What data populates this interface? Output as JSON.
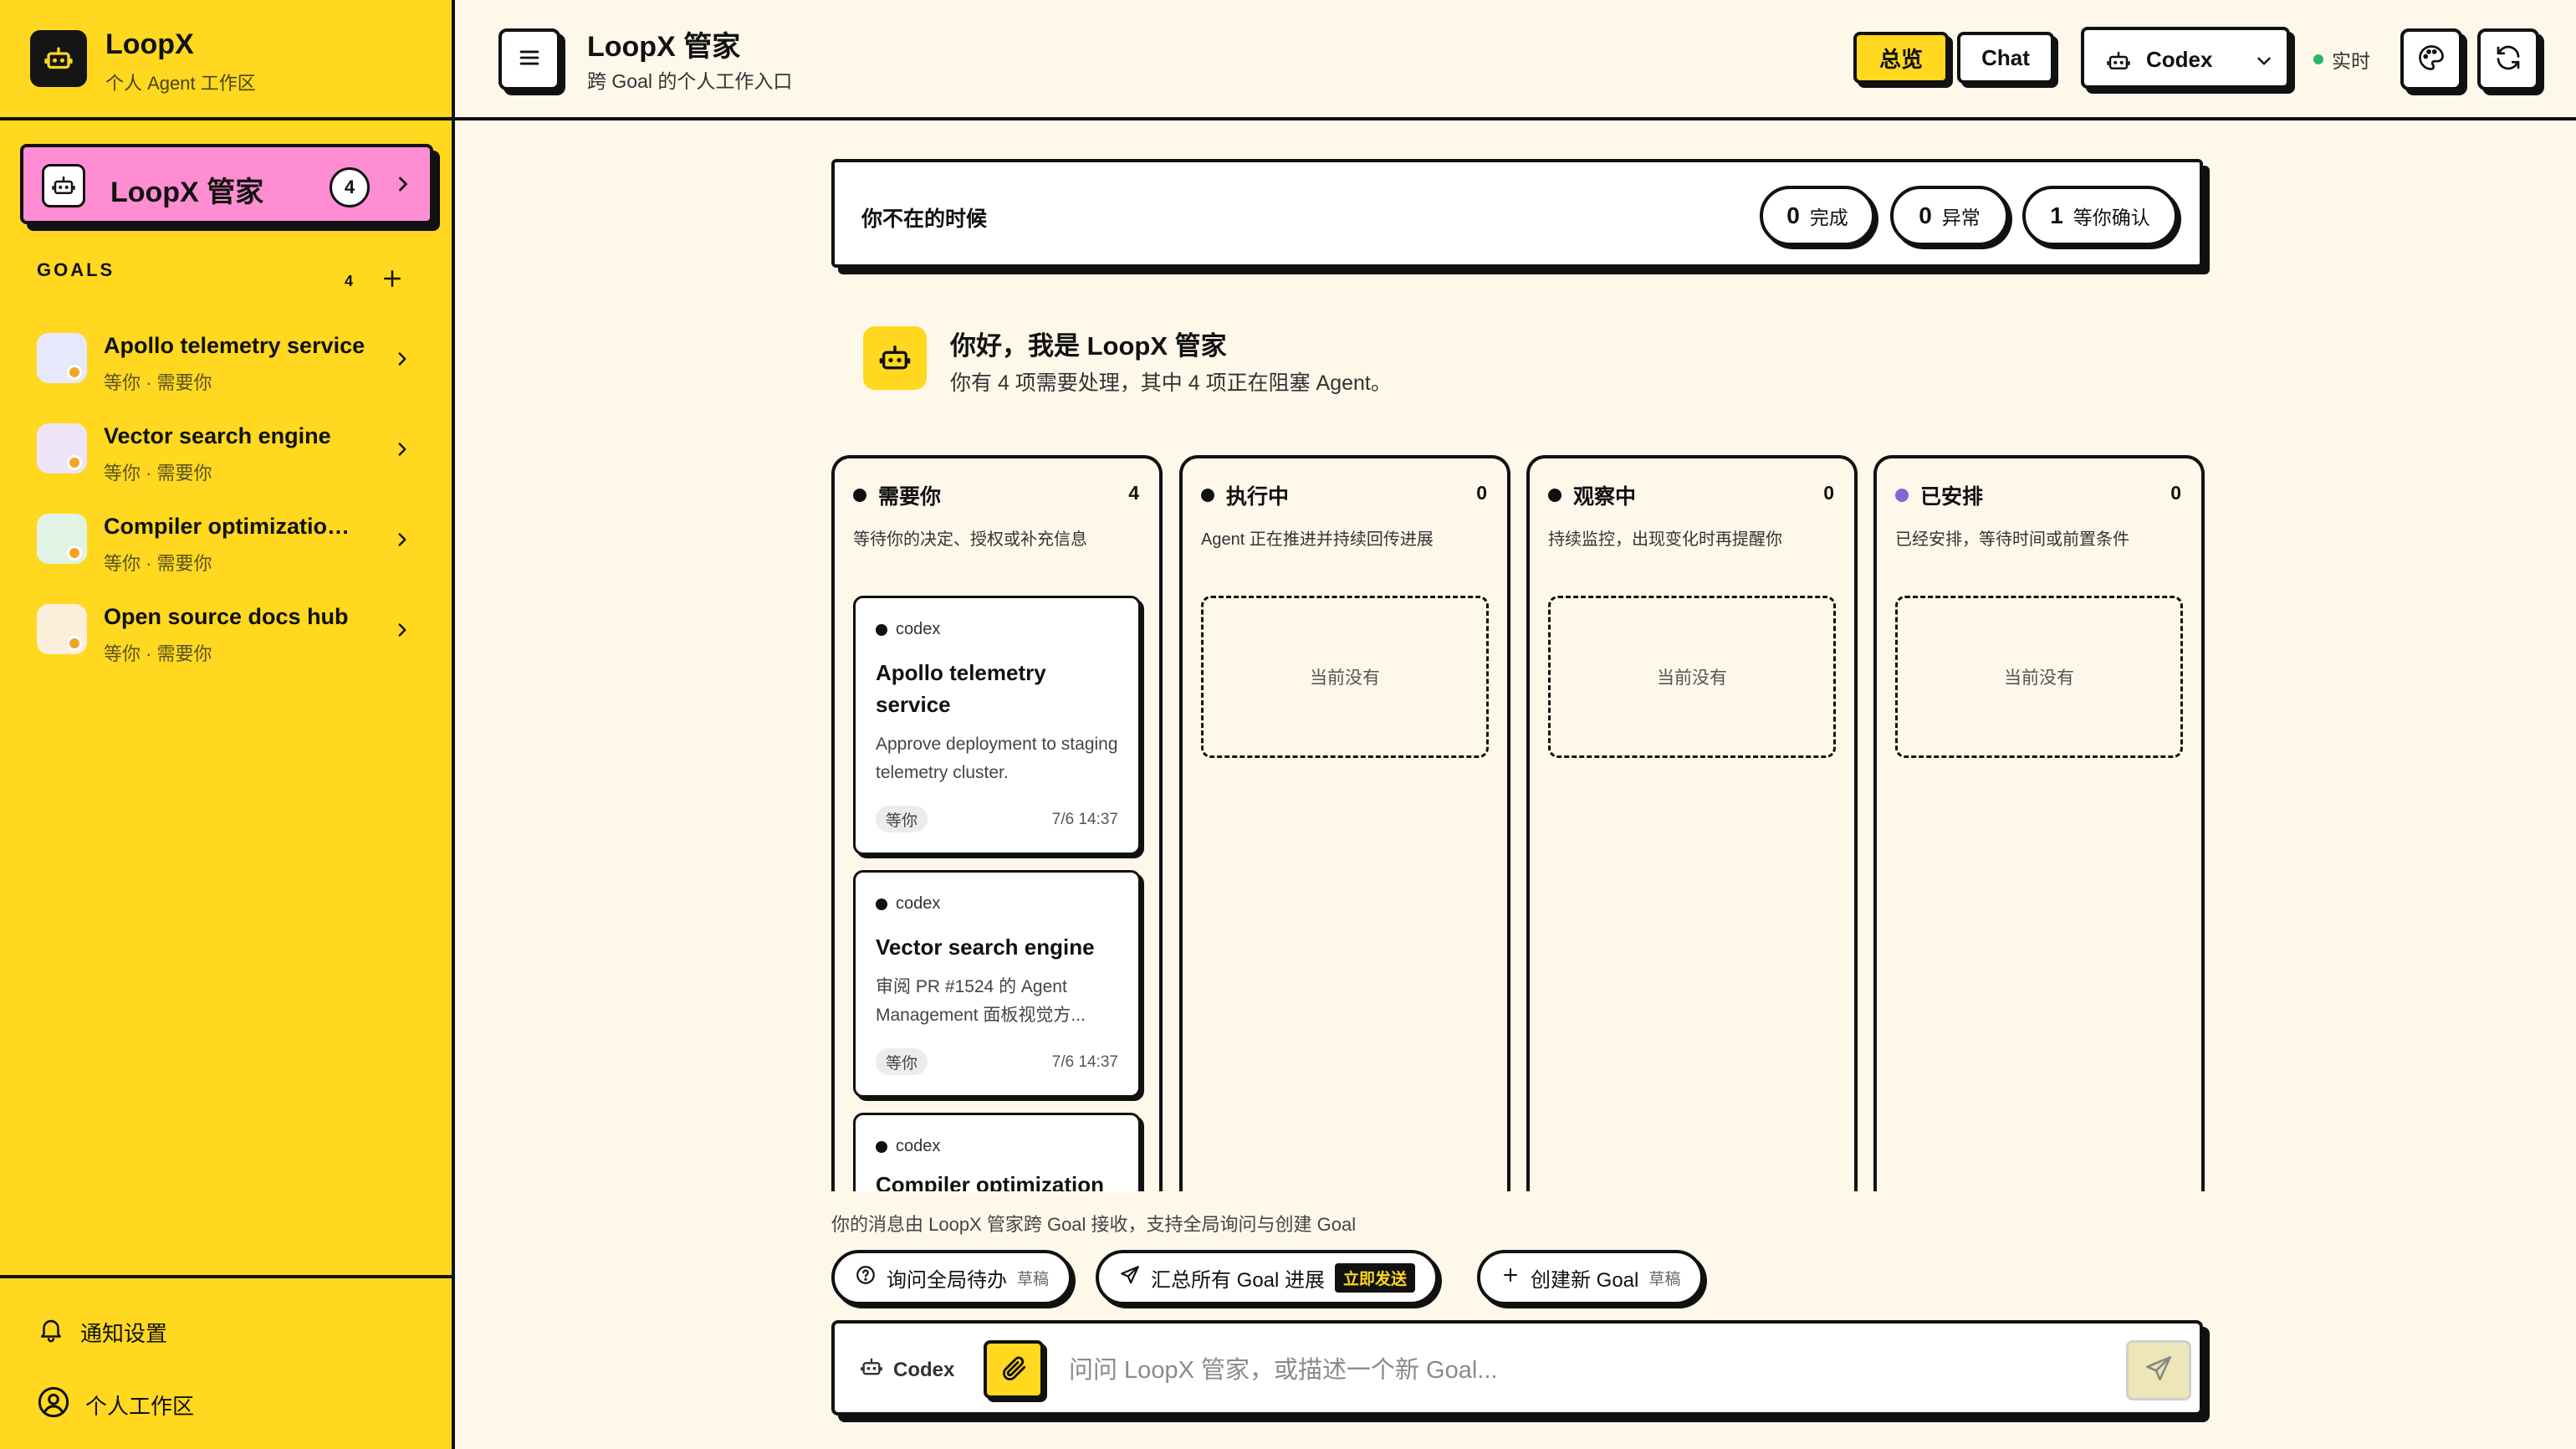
{
  "app": {
    "title": "LoopX",
    "subtitle": "个人 Agent 工作区"
  },
  "sidebar": {
    "butler": {
      "label": "LoopX 管家",
      "count": "4"
    },
    "goals_header": "GOALS",
    "goals_count": "4",
    "goals": [
      {
        "name": "Apollo telemetry service",
        "meta": "等你 · 需要你",
        "avatar_color": "#e6e9fb"
      },
      {
        "name": "Vector search engine",
        "meta": "等你 · 需要你",
        "avatar_color": "#ede4f8"
      },
      {
        "name": "Compiler optimization research",
        "meta": "等你 · 需要你",
        "avatar_color": "#e0f3e4"
      },
      {
        "name": "Open source docs hub",
        "meta": "等你 · 需要你",
        "avatar_color": "#fbeedb"
      }
    ],
    "footer": {
      "notifications": "通知设置",
      "workspace": "个人工作区"
    }
  },
  "header": {
    "title": "LoopX 管家",
    "subtitle": "跨 Goal 的个人工作入口",
    "overview_label": "总览",
    "chat_label": "Chat",
    "agent_label": "Codex",
    "live_label": "实时"
  },
  "away": {
    "title": "你不在的时候",
    "pills": [
      {
        "count": "0",
        "label": "完成"
      },
      {
        "count": "0",
        "label": "异常"
      },
      {
        "count": "1",
        "label": "等你确认"
      }
    ]
  },
  "greeting": {
    "title": "你好，我是 LoopX 管家",
    "subtitle": "你有 4 项需要处理，其中 4 项正在阻塞 Agent。"
  },
  "columns": [
    {
      "title": "需要你",
      "count": "4",
      "desc": "等待你的决定、授权或补充信息",
      "dot_color": "#111111"
    },
    {
      "title": "执行中",
      "count": "0",
      "desc": "Agent 正在推进并持续回传进展",
      "dot_color": "#111111",
      "empty": "当前没有"
    },
    {
      "title": "观察中",
      "count": "0",
      "desc": "持续监控，出现变化时再提醒你",
      "dot_color": "#111111",
      "empty": "当前没有"
    },
    {
      "title": "已安排",
      "count": "0",
      "desc": "已经安排，等待时间或前置条件",
      "dot_color": "#8a63d2",
      "empty": "当前没有"
    }
  ],
  "cards": [
    {
      "agent": "codex",
      "title": "Apollo telemetry service",
      "desc": "Approve deployment to staging telemetry cluster.",
      "tag": "等你",
      "time": "7/6 14:37"
    },
    {
      "agent": "codex",
      "title": "Vector search engine",
      "desc": "审阅 PR #1524 的 Agent Management 面板视觉方...",
      "tag": "等你",
      "time": "7/6 14:37"
    },
    {
      "agent": "codex",
      "title": "Compiler optimization"
    }
  ],
  "composer": {
    "hint": "你的消息由 LoopX 管家跨 Goal 接收，支持全局询问与创建 Goal",
    "chips": [
      {
        "label": "询问全局待办",
        "tag": "草稿"
      },
      {
        "label": "汇总所有 Goal 进展",
        "tag": "立即发送"
      },
      {
        "label": "创建新 Goal",
        "tag": "草稿"
      }
    ],
    "agent_label": "Codex",
    "placeholder": "问问 LoopX 管家，或描述一个新 Goal..."
  },
  "icons": {
    "brand": "robot-icon",
    "menu": "menu-icon",
    "theme": "palette-icon",
    "refresh": "refresh-icon",
    "attach": "paperclip-icon",
    "send": "send-icon"
  },
  "colors": {
    "accent": "#ffd81f",
    "butler_highlight": "#ff8dd3",
    "live": "#2eb36a",
    "goal_status": "#f1a526"
  }
}
